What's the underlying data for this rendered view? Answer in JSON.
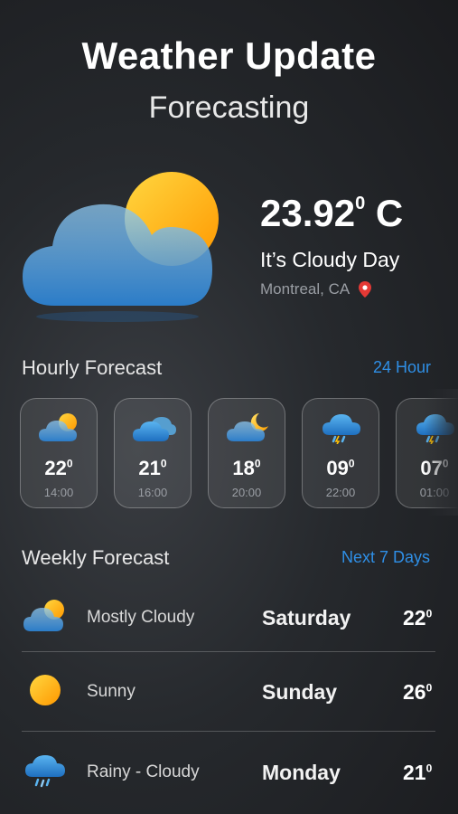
{
  "header": {
    "title": "Weather Update",
    "subtitle": "Forecasting"
  },
  "current": {
    "temp_value": "23.92",
    "temp_sup": "0",
    "temp_unit": " C",
    "condition": "It’s Cloudy Day",
    "location": "Montreal, CA",
    "icon": "cloud-sun-icon"
  },
  "hourly": {
    "title": "Hourly Forecast",
    "link": "24 Hour",
    "items": [
      {
        "temp": "22",
        "sup": "0",
        "time": "14:00",
        "icon": "cloud-sun-icon"
      },
      {
        "temp": "21",
        "sup": "0",
        "time": "16:00",
        "icon": "cloudy-icon"
      },
      {
        "temp": "18",
        "sup": "0",
        "time": "20:00",
        "icon": "cloud-moon-icon"
      },
      {
        "temp": "09",
        "sup": "0",
        "time": "22:00",
        "icon": "rain-cloud-icon"
      },
      {
        "temp": "07",
        "sup": "0",
        "time": "01:00",
        "icon": "rain-cloud-icon"
      }
    ]
  },
  "weekly": {
    "title": "Weekly Forecast",
    "link": "Next 7 Days",
    "items": [
      {
        "condition": "Mostly Cloudy",
        "day": "Saturday",
        "temp": "22",
        "sup": "0",
        "icon": "cloud-sun-icon"
      },
      {
        "condition": "Sunny",
        "day": "Sunday",
        "temp": "26",
        "sup": "0",
        "icon": "sun-icon"
      },
      {
        "condition": "Rainy - Cloudy",
        "day": "Monday",
        "temp": "21",
        "sup": "0",
        "icon": "rain-cloud-icon"
      }
    ]
  },
  "colors": {
    "accent": "#2f8fe6",
    "sun": "#ffb300",
    "cloud": "#3a9be0",
    "pin": "#e53935"
  }
}
